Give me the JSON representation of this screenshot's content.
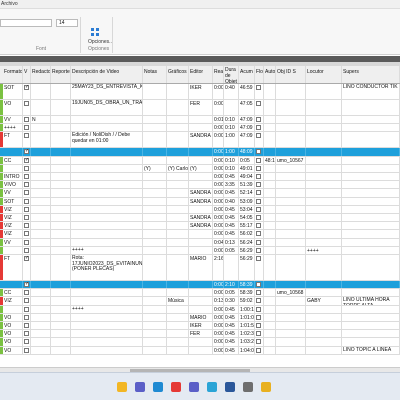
{
  "window": {
    "title": "Archivo"
  },
  "ribbon": {
    "font_value": "",
    "size_value": "14",
    "font_group_label": "Font",
    "options_label": "Opciones...",
    "options_group_label": "Opciones"
  },
  "columns": {
    "formato": "Formato",
    "v": "V",
    "redactor": "Redactor",
    "reportero": "Reporte",
    "descripcion": "Descripción de Video",
    "notas": "Notas",
    "graficos": "Gráficos",
    "editor": "Editor",
    "real": "Real",
    "duracion_objetivo": "Dura de Objet",
    "acumulado": "Acum",
    "flot": "Flot",
    "auto": "Auto",
    "obj_id": "Obj ID S",
    "locutor": "Locutor",
    "supers": "Supers"
  },
  "rows": [
    {
      "formato": "SOT",
      "v": true,
      "desc": "25MAY23_DS_ENTREVISTA_KID_PISTOLA",
      "editor": "IKER",
      "real": "0:00",
      "dur": "0:40",
      "acum": "46:59",
      "supers": "LINO CONDUCTOR TIK",
      "color": "#7bc142"
    },
    {
      "formato": "VO",
      "v": false,
      "desc": "19JUN05_DS_OBRA_UN_TRANVIA_LLAMADO_DESEO",
      "editor": "FER",
      "real": "0:00",
      "dur": "",
      "acum": "47:05",
      "color": "#7bc142"
    },
    {
      "formato": "VV",
      "v": false,
      "redactor": "N",
      "real": "0:01",
      "dur": "0:10",
      "acum": "47:09",
      "color": "#7bc142"
    },
    {
      "formato": "++++",
      "v": false,
      "real": "0:00",
      "dur": "0:10",
      "acum": "47:09",
      "color": "#7bc142"
    },
    {
      "formato": "FT",
      "v": false,
      "desc": "Edición / NoliDish / / Debe quedar en 01:00",
      "editor": "SANDRA",
      "real": "0:00",
      "dur": "1:00",
      "acum": "47:09",
      "color": "#e53935"
    },
    {
      "formato": "",
      "v": true,
      "real": "0:00",
      "dur": "1:00",
      "acum": "48:09",
      "selected": true,
      "color": "#1ea0db"
    },
    {
      "formato": "CC",
      "v": true,
      "real": "0:00",
      "dur": "0:10",
      "acum": "0:05",
      "extra": "48:16",
      "obj": "umo_10567",
      "color": "#7bc142"
    },
    {
      "formato": "",
      "v": false,
      "notas": "(Y)",
      "graficos": "(Y) Carlos",
      "editor": "(Y)",
      "real": "0:00",
      "dur": "0:10",
      "acum": "49:01",
      "color": "#7bc142"
    },
    {
      "formato": "INTRO",
      "v": false,
      "real": "0:00",
      "dur": "0:45",
      "acum": "49:04",
      "color": "#7bc142"
    },
    {
      "formato": "VIVO",
      "v": false,
      "real": "0:00",
      "dur": "3:35",
      "acum": "51:39",
      "color": "#7bc142"
    },
    {
      "formato": "VV",
      "v": false,
      "editor": "SANDRA",
      "real": "0:00",
      "dur": "0:45",
      "acum": "52:14",
      "color": "#7bc142"
    },
    {
      "formato": "SOT",
      "v": false,
      "editor": "SANDRA",
      "real": "0:00",
      "dur": "0:40",
      "acum": "53:09",
      "color": "#7bc142"
    },
    {
      "formato": "VIZ",
      "v": false,
      "real": "0:00",
      "dur": "0:45",
      "acum": "53:04",
      "color": "#e53935"
    },
    {
      "formato": "VIZ",
      "v": false,
      "editor": "SANDRA",
      "real": "0:00",
      "dur": "0:45",
      "acum": "54:05",
      "color": "#e53935"
    },
    {
      "formato": "VIZ",
      "v": false,
      "editor": "SANDRA",
      "real": "0:00",
      "dur": "0:45",
      "acum": "55:17",
      "color": "#e53935"
    },
    {
      "formato": "VIZ",
      "v": false,
      "real": "0:00",
      "dur": "0:45",
      "acum": "56:02",
      "color": "#e53935"
    },
    {
      "formato": "VV",
      "v": false,
      "real": "0:04",
      "dur": "0:13",
      "acum": "56:24",
      "color": "#7bc142"
    },
    {
      "formato": "",
      "v": false,
      "desc": "++++",
      "real": "0:00",
      "dur": "0:05",
      "acum": "56:29",
      "locutor": "++++",
      "color": "#7bc142"
    },
    {
      "formato": "FT",
      "v": true,
      "desc": "Rota: 17JUNIO2023_DS_EVITAINUNDACIONES_IDOMEX (PONER PLECAS)",
      "editor": "MARIO",
      "real": "2:16",
      "dur": "",
      "acum": "56:29",
      "color": "#e53935"
    },
    {
      "formato": "",
      "v": true,
      "real": "0:00",
      "dur": "2:10",
      "acum": "58:39",
      "selected": true,
      "color": "#1ea0db"
    },
    {
      "formato": "CC",
      "v": false,
      "real": "0:00",
      "dur": "0:05",
      "acum": "58:39",
      "obj": "umo_10568",
      "color": "#7bc142"
    },
    {
      "formato": "VIZ",
      "v": false,
      "graficos": "Música",
      "real": "0:13",
      "dur": "0:30",
      "acum": "59:02",
      "locutor": "GABY",
      "supers": "LINO ULTIMA HORA TORRE ALTA",
      "color": "#e53935"
    },
    {
      "formato": "",
      "v": false,
      "desc": "++++",
      "real": "0:00",
      "dur": "0:45",
      "acum": "1:00:1",
      "color": "#7bc142"
    },
    {
      "formato": "VO",
      "v": false,
      "editor": "MARIO",
      "real": "0:00",
      "dur": "0:45",
      "acum": "1:01:0",
      "color": "#7bc142"
    },
    {
      "formato": "VO",
      "v": false,
      "editor": "IKER",
      "real": "0:00",
      "dur": "0:45",
      "acum": "1:01:5",
      "color": "#7bc142"
    },
    {
      "formato": "VO",
      "v": false,
      "editor": "FER",
      "real": "0:00",
      "dur": "0:45",
      "acum": "1:02:3",
      "color": "#7bc142"
    },
    {
      "formato": "VO",
      "v": false,
      "real": "0:00",
      "dur": "0:45",
      "acum": "1:03:2",
      "color": "#7bc142"
    },
    {
      "formato": "VO",
      "v": false,
      "real": "0:00",
      "dur": "0:45",
      "acum": "1:04:0",
      "supers": "LINO TOPIC A LINEA",
      "color": "#7bc142"
    }
  ],
  "taskbar": {
    "icons": [
      "folder-icon",
      "chat-icon",
      "edge-icon",
      "store-icon",
      "teams-icon",
      "image-icon",
      "word-icon",
      "settings-icon",
      "photo-icon"
    ],
    "colors": [
      "#f2b624",
      "#5b5fc7",
      "#1f8ad2",
      "#e53935",
      "#5b5fc7",
      "#2aa4d6",
      "#2b579a",
      "#6e6e6e",
      "#e8b020"
    ]
  }
}
